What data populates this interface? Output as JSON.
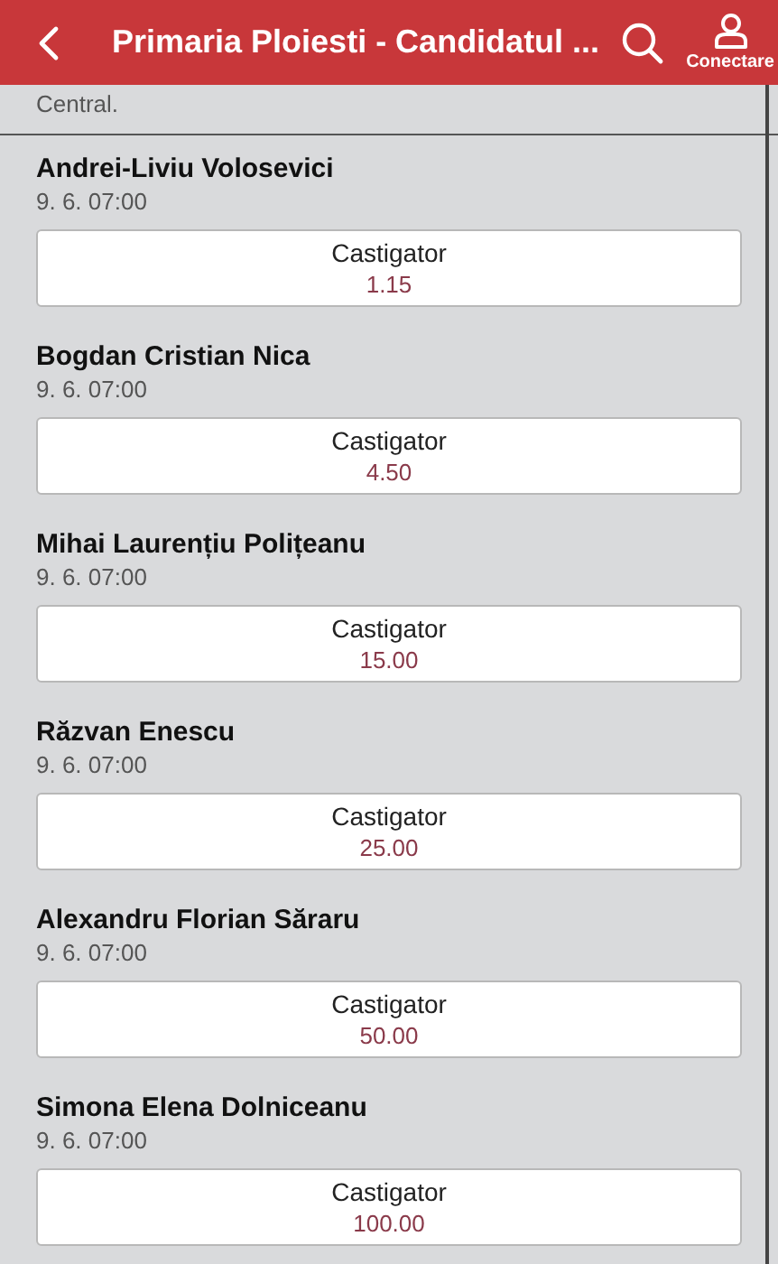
{
  "header": {
    "title": "Primaria Ploiesti - Candidatul ...",
    "login_label": "Conectare"
  },
  "subtitle": "Central.",
  "candidates": [
    {
      "name": "Andrei-Liviu Volosevici",
      "date": "9. 6. 07:00",
      "bet_label": "Castigator",
      "odds": "1.15"
    },
    {
      "name": "Bogdan Cristian Nica",
      "date": "9. 6. 07:00",
      "bet_label": "Castigator",
      "odds": "4.50"
    },
    {
      "name": "Mihai Laurențiu Polițeanu",
      "date": "9. 6. 07:00",
      "bet_label": "Castigator",
      "odds": "15.00"
    },
    {
      "name": "Răzvan Enescu",
      "date": "9. 6. 07:00",
      "bet_label": "Castigator",
      "odds": "25.00"
    },
    {
      "name": "Alexandru Florian Săraru",
      "date": "9. 6. 07:00",
      "bet_label": "Castigator",
      "odds": "50.00"
    },
    {
      "name": "Simona Elena Dolniceanu",
      "date": "9. 6. 07:00",
      "bet_label": "Castigator",
      "odds": "100.00"
    }
  ]
}
